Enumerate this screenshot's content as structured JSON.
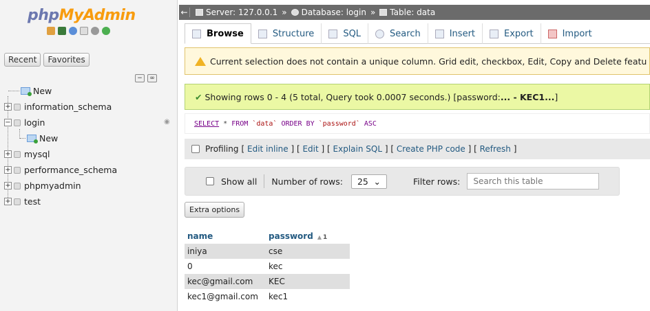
{
  "nav": {
    "logo_php": "php",
    "logo_my": "MyAdmin",
    "recent_label": "Recent",
    "favorites_label": "Favorites",
    "tree": [
      {
        "label": "New",
        "type": "new"
      },
      {
        "label": "information_schema",
        "type": "db"
      },
      {
        "label": "login",
        "type": "db",
        "expanded": true
      },
      {
        "label": "New",
        "type": "new",
        "child": true
      },
      {
        "label": "mysql",
        "type": "db"
      },
      {
        "label": "performance_schema",
        "type": "db"
      },
      {
        "label": "phpmyadmin",
        "type": "db"
      },
      {
        "label": "test",
        "type": "db"
      }
    ]
  },
  "breadcrumb": {
    "server": "Server: 127.0.0.1",
    "database": "Database: login",
    "table": "Table: data",
    "separator": "»"
  },
  "menu": {
    "tabs": [
      "Browse",
      "Structure",
      "SQL",
      "Search",
      "Insert",
      "Export",
      "Import"
    ],
    "active": "Browse"
  },
  "notice": {
    "text": "Current selection does not contain a unique column. Grid edit, checkbox, Edit, Copy and Delete featu"
  },
  "success": {
    "prefix": "Showing rows 0 - 4 (5 total, Query took 0.0007 seconds.) [password: ",
    "bold": "... - KEC1...",
    "suffix": "]"
  },
  "sql": {
    "select": "SELECT",
    "star": " * ",
    "from": "FROM",
    "table": " `data` ",
    "orderby": "ORDER BY",
    "col": " `password` ",
    "asc": "ASC"
  },
  "profiling": {
    "label": "Profiling",
    "links": [
      "Edit inline",
      "Edit",
      "Explain SQL",
      "Create PHP code",
      "Refresh"
    ]
  },
  "filter": {
    "show_all": "Show all",
    "rows_label": "Number of rows:",
    "rows_value": "25",
    "filter_label": "Filter rows:",
    "search_placeholder": "Search this table"
  },
  "extra_options": "Extra options",
  "table": {
    "headers": [
      "name",
      "password"
    ],
    "sort_index": "1",
    "rows": [
      [
        "iniya",
        "cse"
      ],
      [
        "0",
        "kec"
      ],
      [
        "kec@gmail.com",
        "KEC"
      ],
      [
        "kec1@gmail.com",
        "kec1"
      ]
    ]
  },
  "colors": {
    "link": "#235a81",
    "warning_bg": "#fff8dc",
    "success_bg": "#ebf8a4",
    "row_alt": "#dfdfdf"
  }
}
